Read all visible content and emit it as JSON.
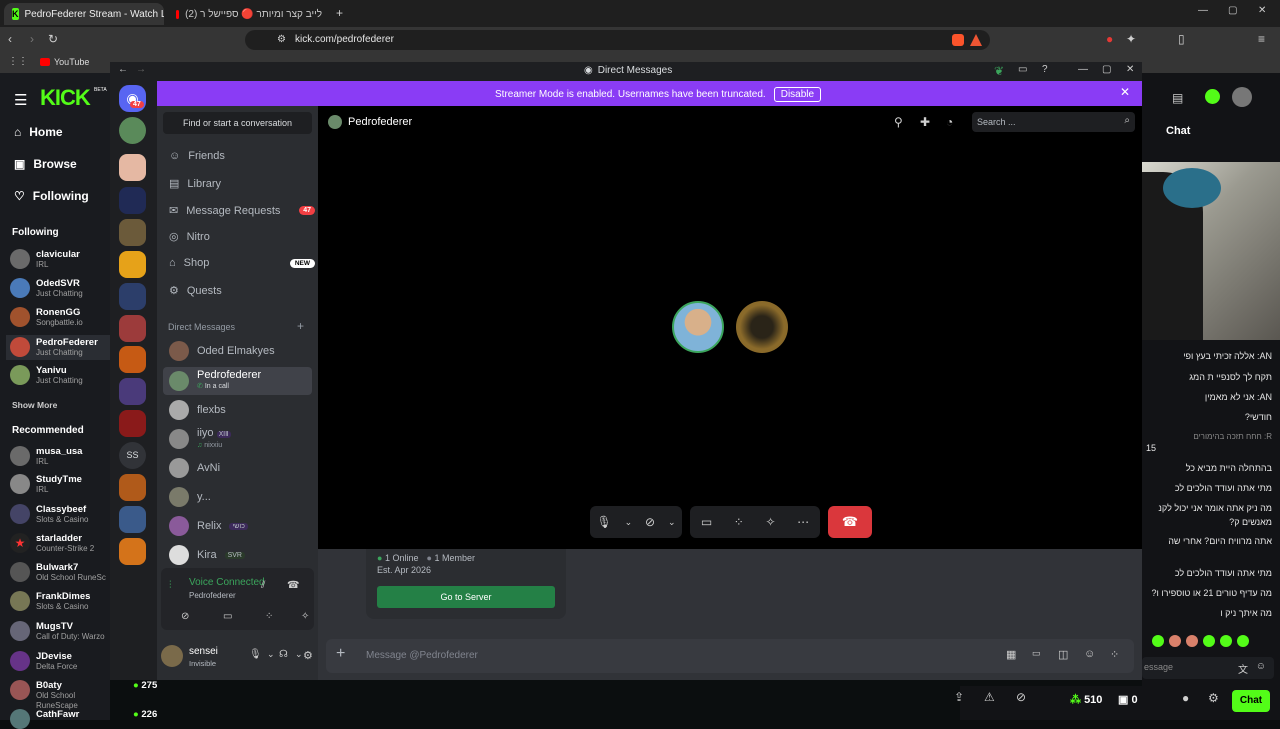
{
  "browser": {
    "tabs": [
      {
        "title": "PedroFederer Stream - Watch Li"
      },
      {
        "title": "לייב קצר ומיותר 🔴 ספיישל ר (2)"
      }
    ],
    "url": "kick.com/pedrofederer",
    "bookmarks": [
      "YouTube"
    ]
  },
  "kick": {
    "logo": "KICK",
    "beta": "BETA",
    "nav": [
      {
        "label": "Home",
        "icon": "home-icon"
      },
      {
        "label": "Browse",
        "icon": "browse-icon"
      },
      {
        "label": "Following",
        "icon": "heart-icon"
      }
    ],
    "following_title": "Following",
    "following": [
      {
        "name": "clavicular",
        "sub": "IRL"
      },
      {
        "name": "OdedSVR",
        "sub": "Just Chatting"
      },
      {
        "name": "RonenGG",
        "sub": "Songbattle.io"
      },
      {
        "name": "PedroFederer",
        "sub": "Just Chatting"
      },
      {
        "name": "Yanivu",
        "sub": "Just Chatting"
      }
    ],
    "show_more": "Show More",
    "recommended_title": "Recommended",
    "recommended": [
      {
        "name": "musa_usa",
        "sub": "IRL"
      },
      {
        "name": "StudyTme",
        "sub": "IRL"
      },
      {
        "name": "Classybeef",
        "sub": "Slots & Casino"
      },
      {
        "name": "starladder",
        "sub": "Counter-Strike 2"
      },
      {
        "name": "Bulwark7",
        "sub": "Old School RuneSc"
      },
      {
        "name": "FrankDimes",
        "sub": "Slots & Casino"
      },
      {
        "name": "MugsTV",
        "sub": "Call of Duty: Warzo"
      },
      {
        "name": "JDevise",
        "sub": "Delta Force"
      },
      {
        "name": "B0aty",
        "sub": "Old School RuneScape",
        "viewers": "275"
      },
      {
        "name": "CathFawr",
        "sub": "",
        "viewers": "226"
      }
    ],
    "chat_title": "Chat",
    "chat_lines": [
      "אללה זכיתי בעץ ופי :AN",
      "תקח לך לסנפיי ת המג",
      "אני לא מאמין :AN",
      "?חודשי",
      "חחח תזכה בהימורים :R",
      "15",
      "בהתחלה היית מביא כל",
      "מתי אתה ועודד הולכים לכ",
      "מה ניק אתה אומר אני יכול לקנ",
      "?מאנשים ק",
      "אתה מרוויח היום? אחרי שה",
      "מתי אתה ועודד הולכים לכ",
      "?מה עדיף טורים 21 או טוספירו ו",
      "מה איתך ניק ו"
    ],
    "chat_placeholder": "essage",
    "bottom": {
      "likes": "510",
      "count": "0",
      "chat_btn": "Chat"
    }
  },
  "discord": {
    "window_title": "Direct Messages",
    "server_badge": "47",
    "banner_text": "Streamer Mode is enabled. Usernames have been truncated.",
    "banner_button": "Disable",
    "search_conv": "Find or start a conversation",
    "nav": [
      {
        "label": "Friends",
        "icon": "friends-icon"
      },
      {
        "label": "Library",
        "icon": "library-icon"
      },
      {
        "label": "Message Requests",
        "icon": "mail-icon",
        "badge": "47"
      },
      {
        "label": "Nitro",
        "icon": "nitro-icon"
      },
      {
        "label": "Shop",
        "icon": "shop-icon",
        "badge": "NEW"
      },
      {
        "label": "Quests",
        "icon": "quests-icon"
      }
    ],
    "dm_header": "Direct Messages",
    "dms": [
      {
        "name": "Oded Elmakyes",
        "sub": ""
      },
      {
        "name": "Pedrofederer",
        "sub": "In a call"
      },
      {
        "name": "flexbs",
        "sub": ""
      },
      {
        "name": "iiyo",
        "sub": "nixxiu",
        "tag": "ⅪⅡ"
      },
      {
        "name": "AvNi",
        "sub": ""
      },
      {
        "name": "y...",
        "sub": ""
      },
      {
        "name": "Relix",
        "sub": "",
        "tag": "כושי"
      },
      {
        "name": "Kira",
        "sub": "",
        "tag": "SVR"
      }
    ],
    "voice": {
      "status": "Voice Connected",
      "channel": "Pedrofederer"
    },
    "user": {
      "name": "sensei",
      "status": "Invisible"
    },
    "call_header": "Pedrofederer",
    "search_placeholder": "Search ...",
    "server_card": {
      "online": "1 Online",
      "members": "1 Member",
      "est": "Est. Apr 2026",
      "button": "Go to Server"
    },
    "message_placeholder": "Message @Pedrofederer"
  }
}
